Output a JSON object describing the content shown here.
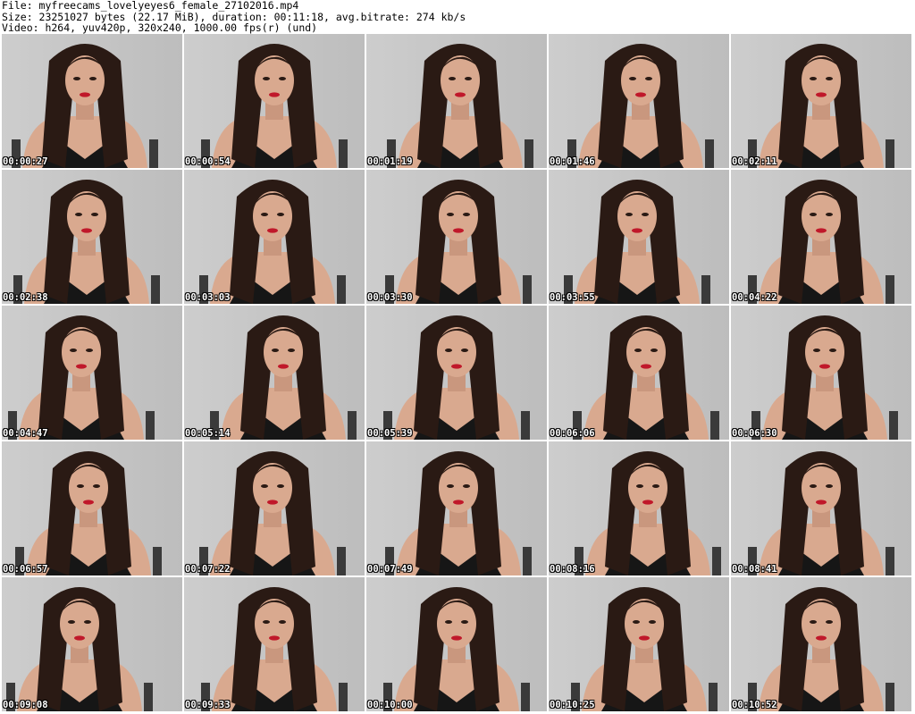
{
  "header": {
    "line1": "File: myfreecams_lovelyeyes6_female_27102016.mp4",
    "line2": "Size: 23251027 bytes (22.17 MiB), duration: 00:11:18, avg.bitrate: 274 kb/s",
    "line3": "Video: h264, yuv420p, 320x240, 1000.00 fps(r) (und)"
  },
  "thumbnails": [
    {
      "timestamp": "00:00:27"
    },
    {
      "timestamp": "00:00:54"
    },
    {
      "timestamp": "00:01:19"
    },
    {
      "timestamp": "00:01:46"
    },
    {
      "timestamp": "00:02:11"
    },
    {
      "timestamp": "00:02:38"
    },
    {
      "timestamp": "00:03:03"
    },
    {
      "timestamp": "00:03:30"
    },
    {
      "timestamp": "00:03:55"
    },
    {
      "timestamp": "00:04:22"
    },
    {
      "timestamp": "00:04:47"
    },
    {
      "timestamp": "00:05:14"
    },
    {
      "timestamp": "00:05:39"
    },
    {
      "timestamp": "00:06:06"
    },
    {
      "timestamp": "00:06:30"
    },
    {
      "timestamp": "00:06:57"
    },
    {
      "timestamp": "00:07:22"
    },
    {
      "timestamp": "00:07:49"
    },
    {
      "timestamp": "00:08:16"
    },
    {
      "timestamp": "00:08:41"
    },
    {
      "timestamp": "00:09:08"
    },
    {
      "timestamp": "00:09:33"
    },
    {
      "timestamp": "00:10:00"
    },
    {
      "timestamp": "00:10:25"
    },
    {
      "timestamp": "00:10:52"
    }
  ],
  "colors": {
    "background": "#ffffff",
    "wall": "#c8c8c8",
    "hair": "#2a1a14",
    "skin": "#d9a98f",
    "lips": "#c0182a",
    "dress": "#161616",
    "timestamp_text": "#ffffff"
  }
}
